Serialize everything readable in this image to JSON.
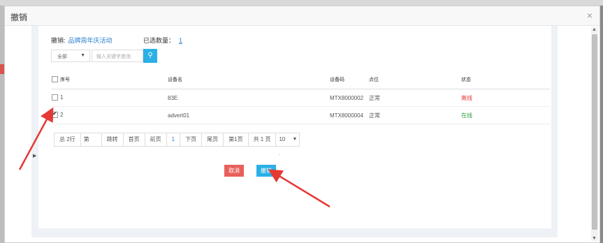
{
  "modal": {
    "title": "撤销",
    "close": "×"
  },
  "header": {
    "activity_label": "撤销:",
    "activity_name": "品牌周年庆活动",
    "selected_label": "已选数量：",
    "selected_count": "1"
  },
  "filter": {
    "select_value": "全部",
    "search_placeholder": "输入关键字查询"
  },
  "table": {
    "headers": [
      "序号",
      "设备名",
      "设备码",
      "点位",
      "状态"
    ],
    "rows": [
      {
        "index": "1",
        "name": "83E",
        "code": "MTX8000002",
        "position": "正常",
        "status": "离线",
        "checked": false
      },
      {
        "index": "2",
        "name": "advert01",
        "code": "MTX8000004",
        "position": "正常",
        "status": "在线",
        "checked": true
      }
    ]
  },
  "pager": {
    "total": "总 2行",
    "page_input": "第",
    "jump": "跳转",
    "first": "首页",
    "prev": "前页",
    "current": "1",
    "next": "下页",
    "last": "尾页",
    "page_no": "第1页",
    "pages": "共 1 页",
    "size": "10"
  },
  "buttons": {
    "cancel": "取消",
    "revoke": "撤销"
  },
  "colors": {
    "accent": "#2bb0e6",
    "danger": "#e8605b",
    "offline": "#e53935",
    "online": "#2e9e3c",
    "arrow": "#e53935"
  }
}
